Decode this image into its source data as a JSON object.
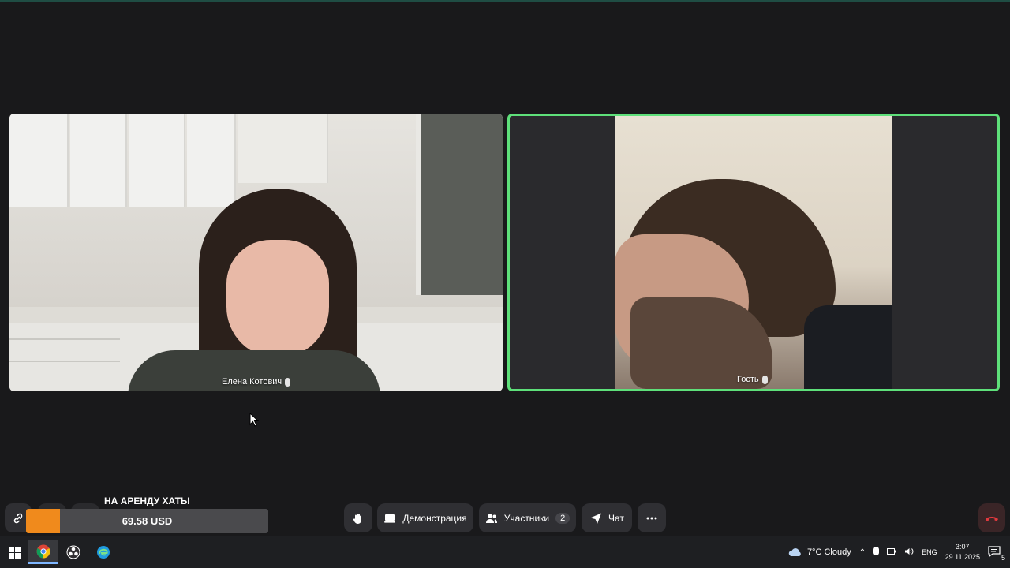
{
  "participants": [
    {
      "name": "Елена Котович"
    },
    {
      "name": "Гость"
    }
  ],
  "controls": {
    "demo_label": "Демонстрация",
    "participants_label": "Участники",
    "participants_count": "2",
    "chat_label": "Чат"
  },
  "donation": {
    "title": "НА АРЕНДУ ХАТЫ",
    "amount": "69.58 USD",
    "min": "0",
    "max": "500",
    "progress": 0.139,
    "fill_color": "#f08a1c"
  },
  "taskbar": {
    "weather": "7°C  Cloudy",
    "language": "ENG",
    "time": "3:07",
    "date": "29.11.2025",
    "notifications": "5"
  },
  "colors": {
    "background": "#19191b",
    "active_speaker_border": "#5ee07a",
    "hangup": "#e0393e"
  }
}
